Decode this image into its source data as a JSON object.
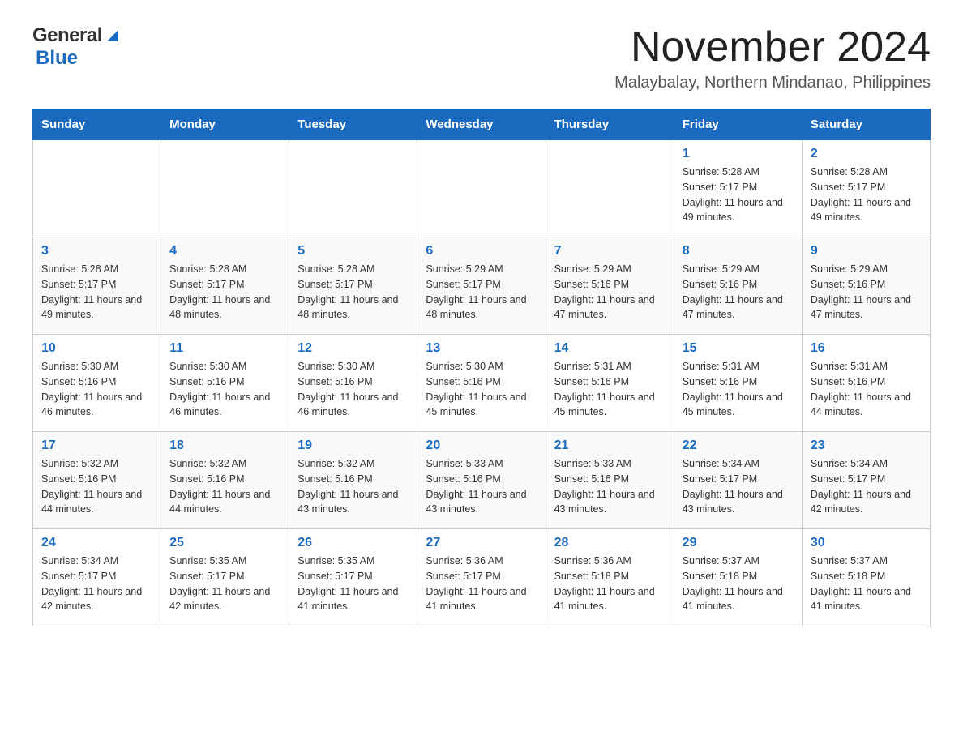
{
  "header": {
    "logo_general": "General",
    "logo_blue": "Blue",
    "month_title": "November 2024",
    "location": "Malaybalay, Northern Mindanao, Philippines"
  },
  "weekdays": [
    "Sunday",
    "Monday",
    "Tuesday",
    "Wednesday",
    "Thursday",
    "Friday",
    "Saturday"
  ],
  "weeks": [
    [
      {
        "day": "",
        "sunrise": "",
        "sunset": "",
        "daylight": ""
      },
      {
        "day": "",
        "sunrise": "",
        "sunset": "",
        "daylight": ""
      },
      {
        "day": "",
        "sunrise": "",
        "sunset": "",
        "daylight": ""
      },
      {
        "day": "",
        "sunrise": "",
        "sunset": "",
        "daylight": ""
      },
      {
        "day": "",
        "sunrise": "",
        "sunset": "",
        "daylight": ""
      },
      {
        "day": "1",
        "sunrise": "5:28 AM",
        "sunset": "5:17 PM",
        "daylight": "11 hours and 49 minutes."
      },
      {
        "day": "2",
        "sunrise": "5:28 AM",
        "sunset": "5:17 PM",
        "daylight": "11 hours and 49 minutes."
      }
    ],
    [
      {
        "day": "3",
        "sunrise": "5:28 AM",
        "sunset": "5:17 PM",
        "daylight": "11 hours and 49 minutes."
      },
      {
        "day": "4",
        "sunrise": "5:28 AM",
        "sunset": "5:17 PM",
        "daylight": "11 hours and 48 minutes."
      },
      {
        "day": "5",
        "sunrise": "5:28 AM",
        "sunset": "5:17 PM",
        "daylight": "11 hours and 48 minutes."
      },
      {
        "day": "6",
        "sunrise": "5:29 AM",
        "sunset": "5:17 PM",
        "daylight": "11 hours and 48 minutes."
      },
      {
        "day": "7",
        "sunrise": "5:29 AM",
        "sunset": "5:16 PM",
        "daylight": "11 hours and 47 minutes."
      },
      {
        "day": "8",
        "sunrise": "5:29 AM",
        "sunset": "5:16 PM",
        "daylight": "11 hours and 47 minutes."
      },
      {
        "day": "9",
        "sunrise": "5:29 AM",
        "sunset": "5:16 PM",
        "daylight": "11 hours and 47 minutes."
      }
    ],
    [
      {
        "day": "10",
        "sunrise": "5:30 AM",
        "sunset": "5:16 PM",
        "daylight": "11 hours and 46 minutes."
      },
      {
        "day": "11",
        "sunrise": "5:30 AM",
        "sunset": "5:16 PM",
        "daylight": "11 hours and 46 minutes."
      },
      {
        "day": "12",
        "sunrise": "5:30 AM",
        "sunset": "5:16 PM",
        "daylight": "11 hours and 46 minutes."
      },
      {
        "day": "13",
        "sunrise": "5:30 AM",
        "sunset": "5:16 PM",
        "daylight": "11 hours and 45 minutes."
      },
      {
        "day": "14",
        "sunrise": "5:31 AM",
        "sunset": "5:16 PM",
        "daylight": "11 hours and 45 minutes."
      },
      {
        "day": "15",
        "sunrise": "5:31 AM",
        "sunset": "5:16 PM",
        "daylight": "11 hours and 45 minutes."
      },
      {
        "day": "16",
        "sunrise": "5:31 AM",
        "sunset": "5:16 PM",
        "daylight": "11 hours and 44 minutes."
      }
    ],
    [
      {
        "day": "17",
        "sunrise": "5:32 AM",
        "sunset": "5:16 PM",
        "daylight": "11 hours and 44 minutes."
      },
      {
        "day": "18",
        "sunrise": "5:32 AM",
        "sunset": "5:16 PM",
        "daylight": "11 hours and 44 minutes."
      },
      {
        "day": "19",
        "sunrise": "5:32 AM",
        "sunset": "5:16 PM",
        "daylight": "11 hours and 43 minutes."
      },
      {
        "day": "20",
        "sunrise": "5:33 AM",
        "sunset": "5:16 PM",
        "daylight": "11 hours and 43 minutes."
      },
      {
        "day": "21",
        "sunrise": "5:33 AM",
        "sunset": "5:16 PM",
        "daylight": "11 hours and 43 minutes."
      },
      {
        "day": "22",
        "sunrise": "5:34 AM",
        "sunset": "5:17 PM",
        "daylight": "11 hours and 43 minutes."
      },
      {
        "day": "23",
        "sunrise": "5:34 AM",
        "sunset": "5:17 PM",
        "daylight": "11 hours and 42 minutes."
      }
    ],
    [
      {
        "day": "24",
        "sunrise": "5:34 AM",
        "sunset": "5:17 PM",
        "daylight": "11 hours and 42 minutes."
      },
      {
        "day": "25",
        "sunrise": "5:35 AM",
        "sunset": "5:17 PM",
        "daylight": "11 hours and 42 minutes."
      },
      {
        "day": "26",
        "sunrise": "5:35 AM",
        "sunset": "5:17 PM",
        "daylight": "11 hours and 41 minutes."
      },
      {
        "day": "27",
        "sunrise": "5:36 AM",
        "sunset": "5:17 PM",
        "daylight": "11 hours and 41 minutes."
      },
      {
        "day": "28",
        "sunrise": "5:36 AM",
        "sunset": "5:18 PM",
        "daylight": "11 hours and 41 minutes."
      },
      {
        "day": "29",
        "sunrise": "5:37 AM",
        "sunset": "5:18 PM",
        "daylight": "11 hours and 41 minutes."
      },
      {
        "day": "30",
        "sunrise": "5:37 AM",
        "sunset": "5:18 PM",
        "daylight": "11 hours and 41 minutes."
      }
    ]
  ]
}
